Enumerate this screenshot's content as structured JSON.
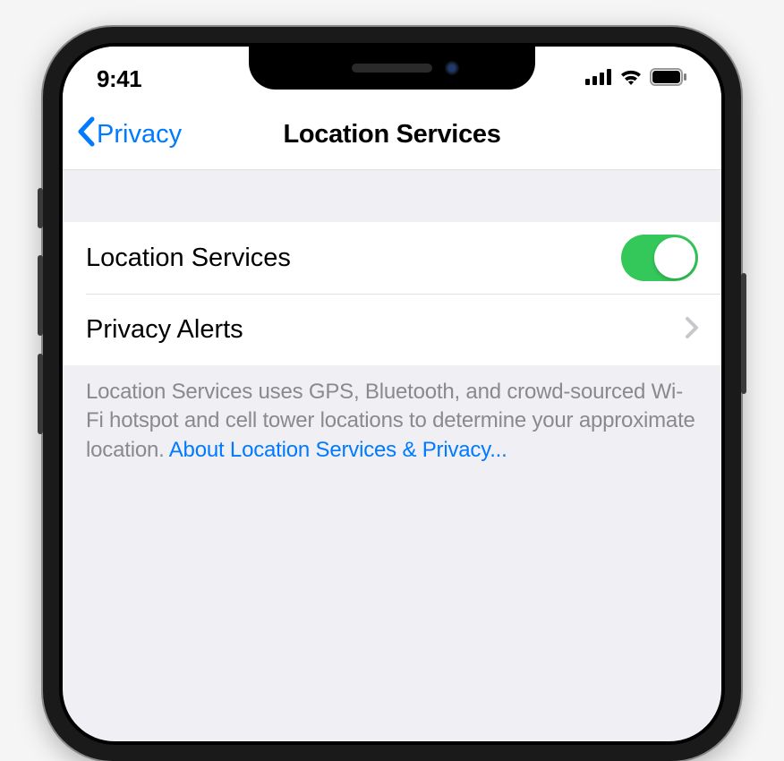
{
  "status_bar": {
    "time": "9:41"
  },
  "nav": {
    "back_label": "Privacy",
    "title": "Location Services"
  },
  "rows": {
    "location_services": {
      "label": "Location Services",
      "toggle_on": true
    },
    "privacy_alerts": {
      "label": "Privacy Alerts"
    }
  },
  "footer": {
    "text": "Location Services uses GPS, Bluetooth, and crowd-sourced Wi-Fi hotspot and cell tower locations to determine your approximate location. ",
    "link_text": "About Location Services & Privacy..."
  }
}
